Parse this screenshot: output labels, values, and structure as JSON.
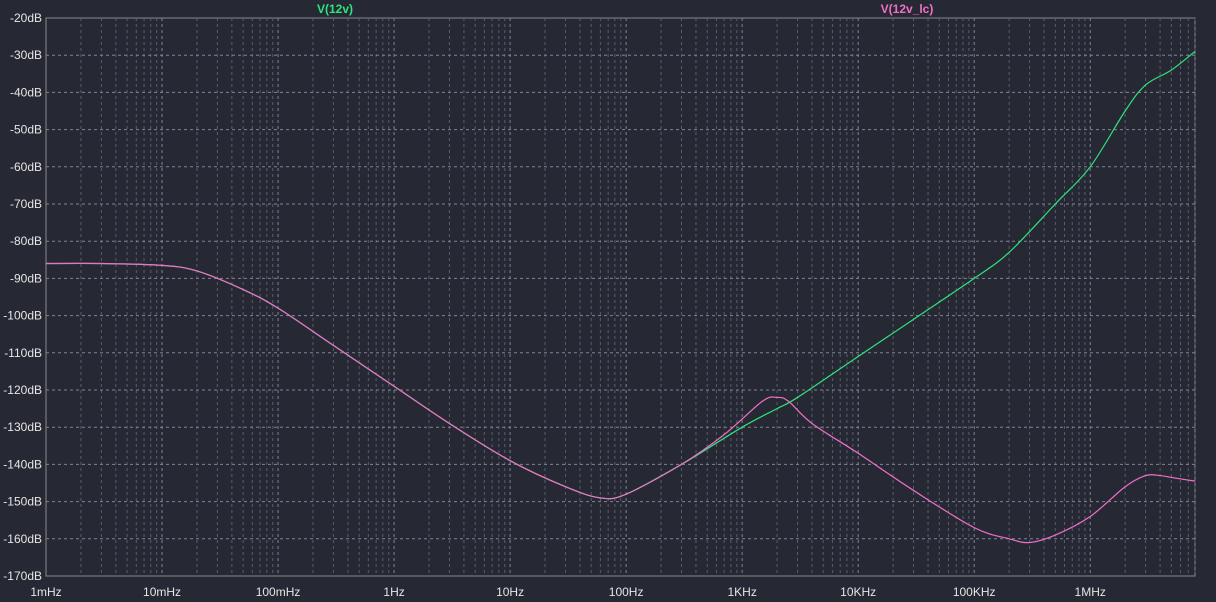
{
  "chart_data": {
    "type": "line",
    "x_scale": "log",
    "xlim": [
      "1mHz",
      "1MHz+"
    ],
    "xlim_hz": [
      0.001,
      8000000
    ],
    "ylim": [
      -170,
      -20
    ],
    "grid": true,
    "x_ticks": [
      "1mHz",
      "10mHz",
      "100mHz",
      "1Hz",
      "10Hz",
      "100Hz",
      "1KHz",
      "10KHz",
      "100KHz",
      "1MHz"
    ],
    "y_ticks": [
      "-20dB",
      "-30dB",
      "-40dB",
      "-50dB",
      "-60dB",
      "-70dB",
      "-80dB",
      "-90dB",
      "-100dB",
      "-110dB",
      "-120dB",
      "-130dB",
      "-140dB",
      "-150dB",
      "-160dB",
      "-170dB"
    ],
    "series": [
      {
        "name": "V(12v)",
        "color": "#2ee57a",
        "x": [
          0.001,
          0.003,
          0.01,
          0.02,
          0.05,
          0.1,
          0.3,
          1,
          3,
          10,
          30,
          60,
          100,
          300,
          1000,
          2000,
          3000,
          10000,
          30000,
          100000,
          200000,
          500000,
          1000000,
          2000000,
          3000000,
          5000000,
          8000000
        ],
        "y": [
          -86,
          -86,
          -86.5,
          -88,
          -93,
          -98,
          -108,
          -119,
          -129,
          -139,
          -146,
          -149,
          -148,
          -140,
          -130,
          -125,
          -122,
          -111,
          -101,
          -90,
          -83,
          -70,
          -60,
          -45,
          -38,
          -34,
          -29
        ]
      },
      {
        "name": "V(12v_lc)",
        "color": "#f070c8",
        "x": [
          0.001,
          0.003,
          0.01,
          0.02,
          0.05,
          0.1,
          0.3,
          1,
          3,
          10,
          30,
          60,
          100,
          300,
          700,
          1500,
          2000,
          2500,
          4000,
          10000,
          30000,
          100000,
          200000,
          300000,
          500000,
          1000000,
          2000000,
          3000000,
          4000000,
          5000000,
          8000000
        ],
        "y": [
          -86,
          -86,
          -86.5,
          -88,
          -93,
          -98,
          -108,
          -119,
          -129,
          -139,
          -146,
          -149,
          -148,
          -140,
          -132,
          -123,
          -122,
          -123,
          -129,
          -137,
          -147,
          -157,
          -160,
          -161,
          -159,
          -154,
          -146,
          -143,
          -143,
          -143.5,
          -144.5
        ]
      }
    ]
  }
}
